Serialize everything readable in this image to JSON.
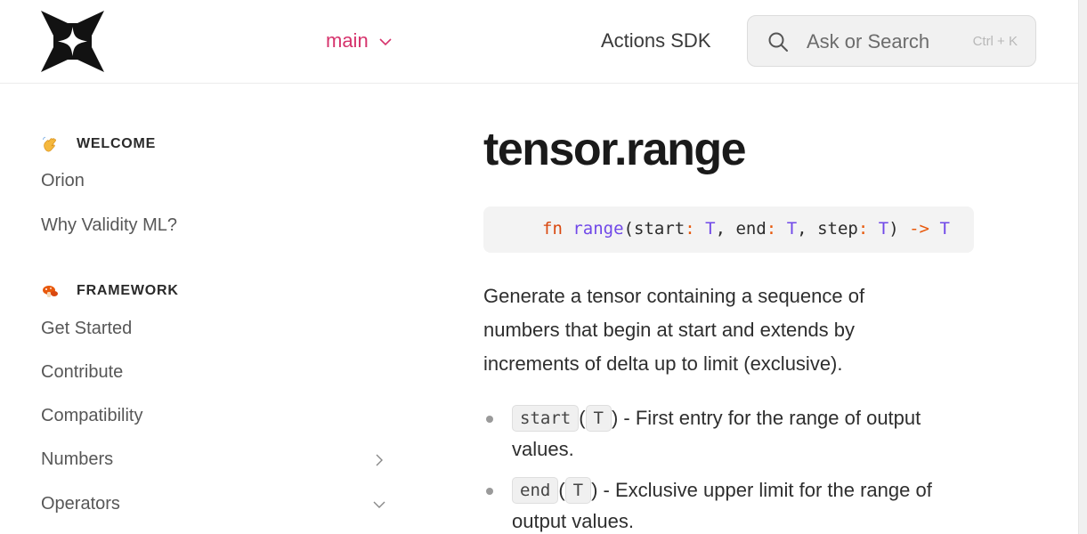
{
  "header": {
    "branch_label": "main",
    "actions_link": "Actions SDK",
    "search_placeholder": "Ask or Search",
    "search_shortcut": "Ctrl + K"
  },
  "sidebar": {
    "sections": [
      {
        "title": "WELCOME",
        "icon": "waving-hand-icon",
        "items": [
          {
            "label": "Orion"
          },
          {
            "label": "Why Validity ML?"
          }
        ]
      },
      {
        "title": "FRAMEWORK",
        "icon": "mushroom-icon",
        "items": [
          {
            "label": "Get Started"
          },
          {
            "label": "Contribute"
          },
          {
            "label": "Compatibility"
          },
          {
            "label": "Numbers",
            "chevron": "right"
          },
          {
            "label": "Operators",
            "chevron": "down"
          }
        ]
      }
    ]
  },
  "content": {
    "title": "tensor.range",
    "signature": {
      "kw": "fn",
      "name": "range",
      "open": "(",
      "p1": "start",
      "p2": "end",
      "p3": "step",
      "colon": ":",
      "type": "T",
      "comma": ",",
      "close": ")",
      "arrow": "->",
      "ret": "T"
    },
    "description": "Generate a tensor containing a sequence of numbers that begin at start and extends by increments of delta up to limit (exclusive).",
    "params": [
      {
        "name": "start",
        "type": "T",
        "text": " - First entry for the range of output values."
      },
      {
        "name": "end",
        "type": "T",
        "text": " - Exclusive upper limit for the range of output values."
      }
    ]
  },
  "colors": {
    "accent": "#d6336c",
    "keyword": "#d9480f",
    "function": "#7048e8"
  }
}
